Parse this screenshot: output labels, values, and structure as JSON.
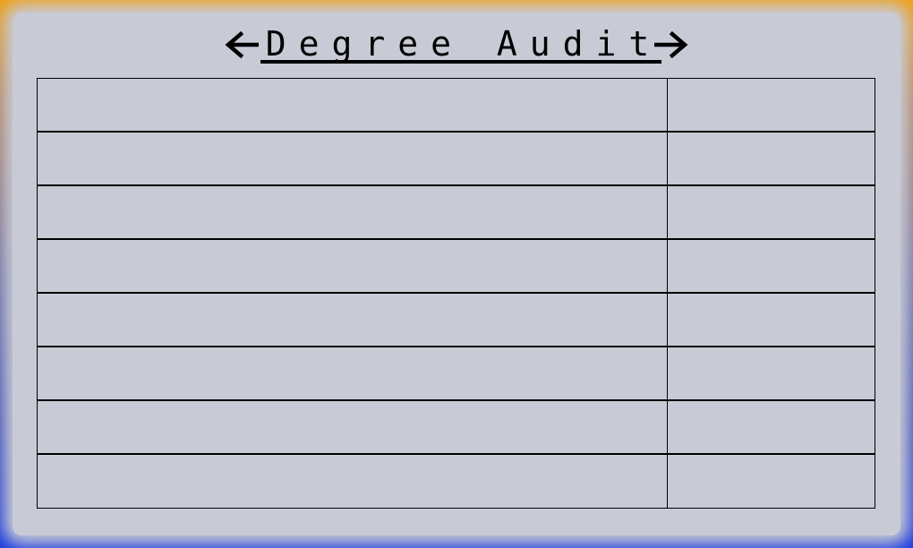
{
  "title": "Degree Audit",
  "nav": {
    "prev_icon": "left-arrow-icon",
    "next_icon": "right-arrow-icon"
  },
  "colors": {
    "panel": "#c8cbd5",
    "frame_top": "#f0a010",
    "frame_bottom": "#1a3ae0",
    "line": "#000000"
  },
  "rows": [
    {
      "name": "",
      "status": ""
    },
    {
      "name": "",
      "status": ""
    },
    {
      "name": "",
      "status": ""
    },
    {
      "name": "",
      "status": ""
    },
    {
      "name": "",
      "status": ""
    },
    {
      "name": "",
      "status": ""
    },
    {
      "name": "",
      "status": ""
    },
    {
      "name": "",
      "status": ""
    }
  ]
}
